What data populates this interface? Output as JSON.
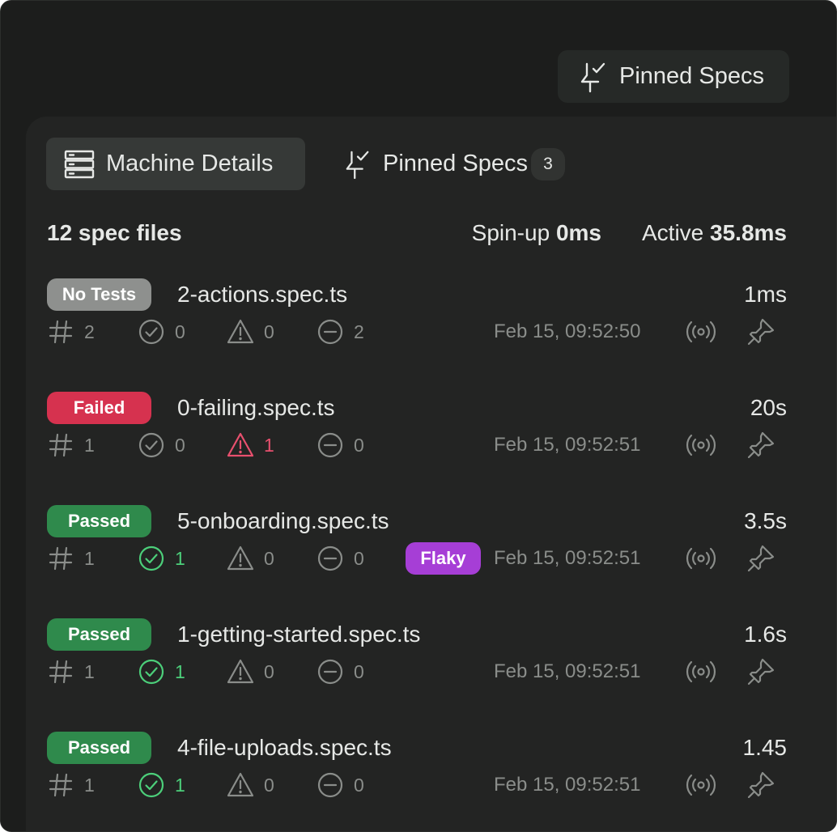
{
  "header": {
    "pinned_button_label": "Pinned Specs"
  },
  "tabs": {
    "machine_details": "Machine Details",
    "pinned_specs": "Pinned Specs",
    "pinned_count": "3"
  },
  "summary": {
    "spec_files": "12 spec files",
    "spinup_label": "Spin-up",
    "spinup_value": "0ms",
    "active_label": "Active",
    "active_value": "35.8ms"
  },
  "colors": {
    "no_tests": "#8e908e",
    "failed": "#d6324f",
    "passed": "#2f8a4c",
    "flaky": "#a63ed6",
    "pass_icon": "#4ccf7a",
    "fail_icon": "#e8506e"
  },
  "icons": [
    "pin-check-icon",
    "server-icon",
    "hash-icon",
    "check-circle-icon",
    "warning-triangle-icon",
    "minus-circle-icon",
    "broadcast-icon",
    "pin-icon"
  ],
  "specs": [
    {
      "status": "No Tests",
      "name": "2-actions.spec.ts",
      "duration": "1ms",
      "tests": "2",
      "passed": "0",
      "failed": "0",
      "skipped": "2",
      "flaky": "",
      "timestamp": "Feb 15, 09:52:50"
    },
    {
      "status": "Failed",
      "name": "0-failing.spec.ts",
      "duration": "20s",
      "tests": "1",
      "passed": "0",
      "failed": "1",
      "skipped": "0",
      "flaky": "",
      "timestamp": "Feb 15, 09:52:51"
    },
    {
      "status": "Passed",
      "name": "5-onboarding.spec.ts",
      "duration": "3.5s",
      "tests": "1",
      "passed": "1",
      "failed": "0",
      "skipped": "0",
      "flaky": "Flaky",
      "timestamp": "Feb 15, 09:52:51"
    },
    {
      "status": "Passed",
      "name": "1-getting-started.spec.ts",
      "duration": "1.6s",
      "tests": "1",
      "passed": "1",
      "failed": "0",
      "skipped": "0",
      "flaky": "",
      "timestamp": "Feb 15, 09:52:51"
    },
    {
      "status": "Passed",
      "name": "4-file-uploads.spec.ts",
      "duration": "1.45",
      "tests": "1",
      "passed": "1",
      "failed": "0",
      "skipped": "0",
      "flaky": "",
      "timestamp": "Feb 15, 09:52:51"
    }
  ]
}
